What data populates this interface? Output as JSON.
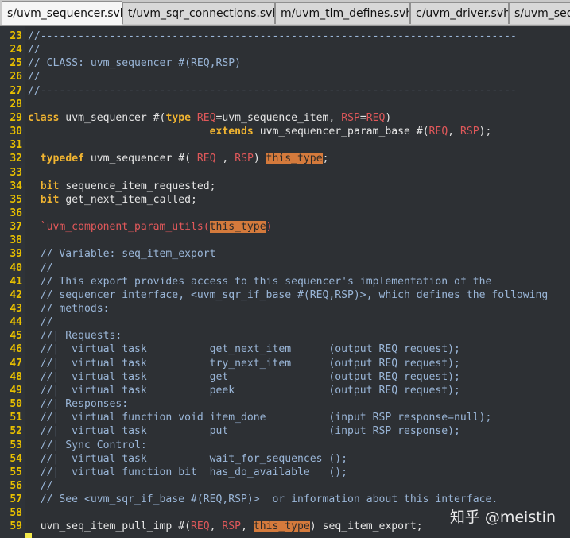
{
  "tabs": [
    {
      "label": "s/uvm_sequencer.svh",
      "active": true
    },
    {
      "label": "t/uvm_sqr_connections.svh",
      "active": false
    },
    {
      "label": "m/uvm_tlm_defines.svh",
      "active": false
    },
    {
      "label": "c/uvm_driver.svh",
      "active": false
    },
    {
      "label": "s/uvm_seq",
      "active": false
    }
  ],
  "colors": {
    "background": "#2d3034",
    "line_number": "#e8c000",
    "keyword": "#f0b431",
    "comment": "#9ab6d8",
    "macro": "#e0585a",
    "highlight": "#d47a3c"
  },
  "watermark": "知乎 @meistin",
  "lines": [
    {
      "n": "23",
      "tokens": [
        {
          "t": "//----------------------------------------------------------------------------",
          "c": "cm"
        }
      ]
    },
    {
      "n": "24",
      "tokens": [
        {
          "t": "//",
          "c": "cm"
        }
      ]
    },
    {
      "n": "25",
      "tokens": [
        {
          "t": "// CLASS: uvm_sequencer #(REQ,RSP)",
          "c": "cm"
        }
      ]
    },
    {
      "n": "26",
      "tokens": [
        {
          "t": "//",
          "c": "cm"
        }
      ]
    },
    {
      "n": "27",
      "tokens": [
        {
          "t": "//----------------------------------------------------------------------------",
          "c": "cm"
        }
      ]
    },
    {
      "n": "28",
      "tokens": []
    },
    {
      "n": "29",
      "tokens": [
        {
          "t": "class",
          "c": "kw"
        },
        {
          "t": " uvm_sequencer #(",
          "c": ""
        },
        {
          "t": "type",
          "c": "kw"
        },
        {
          "t": " ",
          "c": ""
        },
        {
          "t": "REQ",
          "c": "str"
        },
        {
          "t": "=uvm_sequence_item, ",
          "c": ""
        },
        {
          "t": "RSP",
          "c": "str"
        },
        {
          "t": "=",
          "c": ""
        },
        {
          "t": "REQ",
          "c": "str"
        },
        {
          "t": ")",
          "c": ""
        }
      ]
    },
    {
      "n": "30",
      "tokens": [
        {
          "t": "                             ",
          "c": ""
        },
        {
          "t": "extends",
          "c": "kw"
        },
        {
          "t": " uvm_sequencer_param_base #(",
          "c": ""
        },
        {
          "t": "REQ",
          "c": "str"
        },
        {
          "t": ", ",
          "c": ""
        },
        {
          "t": "RSP",
          "c": "str"
        },
        {
          "t": ");",
          "c": ""
        }
      ]
    },
    {
      "n": "31",
      "tokens": []
    },
    {
      "n": "32",
      "tokens": [
        {
          "t": "  ",
          "c": ""
        },
        {
          "t": "typedef",
          "c": "kw"
        },
        {
          "t": " uvm_sequencer #( ",
          "c": ""
        },
        {
          "t": "REQ",
          "c": "str"
        },
        {
          "t": " , ",
          "c": ""
        },
        {
          "t": "RSP",
          "c": "str"
        },
        {
          "t": ") ",
          "c": ""
        },
        {
          "t": "this_type",
          "c": "hl"
        },
        {
          "t": ";",
          "c": ""
        }
      ]
    },
    {
      "n": "33",
      "tokens": []
    },
    {
      "n": "34",
      "tokens": [
        {
          "t": "  ",
          "c": ""
        },
        {
          "t": "bit",
          "c": "kw"
        },
        {
          "t": " sequence_item_requested;",
          "c": ""
        }
      ]
    },
    {
      "n": "35",
      "tokens": [
        {
          "t": "  ",
          "c": ""
        },
        {
          "t": "bit",
          "c": "kw"
        },
        {
          "t": " get_next_item_called;",
          "c": ""
        }
      ]
    },
    {
      "n": "36",
      "tokens": []
    },
    {
      "n": "37",
      "tokens": [
        {
          "t": "  `uvm_component_param_utils(",
          "c": "mc"
        },
        {
          "t": "this_type",
          "c": "hl"
        },
        {
          "t": ")",
          "c": "mc"
        }
      ]
    },
    {
      "n": "38",
      "tokens": []
    },
    {
      "n": "39",
      "tokens": [
        {
          "t": "  // Variable: seq_item_export",
          "c": "cm"
        }
      ]
    },
    {
      "n": "40",
      "tokens": [
        {
          "t": "  //",
          "c": "cm"
        }
      ]
    },
    {
      "n": "41",
      "tokens": [
        {
          "t": "  // This export provides access to this sequencer's implementation of the",
          "c": "cm"
        }
      ]
    },
    {
      "n": "42",
      "tokens": [
        {
          "t": "  // sequencer interface, <uvm_sqr_if_base #(REQ,RSP)>, which defines the following",
          "c": "cm"
        }
      ]
    },
    {
      "n": "43",
      "tokens": [
        {
          "t": "  // methods:",
          "c": "cm"
        }
      ]
    },
    {
      "n": "44",
      "tokens": [
        {
          "t": "  //",
          "c": "cm"
        }
      ]
    },
    {
      "n": "45",
      "tokens": [
        {
          "t": "  //| Requests:",
          "c": "cm"
        }
      ]
    },
    {
      "n": "46",
      "tokens": [
        {
          "t": "  //|  virtual task          get_next_item      (output REQ request);",
          "c": "cm"
        }
      ]
    },
    {
      "n": "47",
      "tokens": [
        {
          "t": "  //|  virtual task          try_next_item      (output REQ request);",
          "c": "cm"
        }
      ]
    },
    {
      "n": "48",
      "tokens": [
        {
          "t": "  //|  virtual task          get                (output REQ request);",
          "c": "cm"
        }
      ]
    },
    {
      "n": "49",
      "tokens": [
        {
          "t": "  //|  virtual task          peek               (output REQ request);",
          "c": "cm"
        }
      ]
    },
    {
      "n": "50",
      "tokens": [
        {
          "t": "  //| Responses:",
          "c": "cm"
        }
      ]
    },
    {
      "n": "51",
      "tokens": [
        {
          "t": "  //|  virtual function void item_done          (input RSP response=null);",
          "c": "cm"
        }
      ]
    },
    {
      "n": "52",
      "tokens": [
        {
          "t": "  //|  virtual task          put                (input RSP response);",
          "c": "cm"
        }
      ]
    },
    {
      "n": "53",
      "tokens": [
        {
          "t": "  //| Sync Control:",
          "c": "cm"
        }
      ]
    },
    {
      "n": "54",
      "tokens": [
        {
          "t": "  //|  virtual task          wait_for_sequences ();",
          "c": "cm"
        }
      ]
    },
    {
      "n": "55",
      "tokens": [
        {
          "t": "  //|  virtual function bit  has_do_available   ();",
          "c": "cm"
        }
      ]
    },
    {
      "n": "56",
      "tokens": [
        {
          "t": "  //",
          "c": "cm"
        }
      ]
    },
    {
      "n": "57",
      "tokens": [
        {
          "t": "  // See <uvm_sqr_if_base #(REQ,RSP)>  or information about this interface.",
          "c": "cm"
        }
      ]
    },
    {
      "n": "58",
      "tokens": []
    },
    {
      "n": "59",
      "tokens": [
        {
          "t": "  uvm_seq_item_pull_imp #(",
          "c": ""
        },
        {
          "t": "REQ",
          "c": "str"
        },
        {
          "t": ", ",
          "c": ""
        },
        {
          "t": "RSP",
          "c": "str"
        },
        {
          "t": ", ",
          "c": ""
        },
        {
          "t": "this_type",
          "c": "hl"
        },
        {
          "t": ") seq_item_export;",
          "c": ""
        }
      ]
    }
  ]
}
